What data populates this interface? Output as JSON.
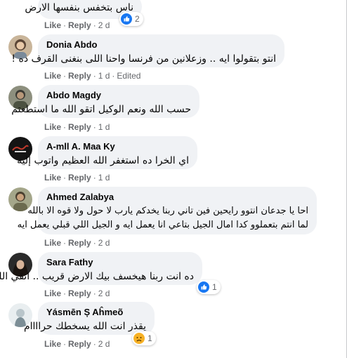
{
  "actions": {
    "like": "Like",
    "reply": "Reply",
    "sep": "·"
  },
  "comments": [
    {
      "name": "",
      "lines": [
        "ناس بتخفس بنفسها الارض"
      ],
      "time": "2 d",
      "edited": "",
      "reaction": {
        "icon": "like-icon",
        "count": "2"
      }
    },
    {
      "name": "Donia Abdo",
      "lines": [
        "انتو بتقولوا ايه .. وزعلانين من فرنسا واحنا اللى بنغنى القرف ده !"
      ],
      "time": "1 d",
      "edited": "Edited",
      "reaction": null
    },
    {
      "name": "Abdo Magdy",
      "lines": [
        "حسب الله ونعم الوكيل اتقو الله ما استطعتم"
      ],
      "time": "1 d",
      "edited": "",
      "reaction": null
    },
    {
      "name": "A-mll A. Maa Ky",
      "lines": [
        "اي الخرا ده استغفر الله العظيم واتوب إليه"
      ],
      "time": "1 d",
      "edited": "",
      "reaction": null
    },
    {
      "name": "Ahmed Zalabya",
      "lines": [
        "احا يا جدعان انتوو رايحين فين تاني ربنا يخدكم يارب لا حول ولا قوه الا بالله",
        "لما انتم بتعملوو كدا امال الجيل بتاعي انا يعمل ايه و الجيل اللي قبلي يعمل ايه"
      ],
      "time": "2 d",
      "edited": "",
      "reaction": null
    },
    {
      "name": "Sara Fathy",
      "lines": [
        "ده انت ربنا هيخسف بيك الارض قريب .. اتقي الله"
      ],
      "time": "2 d",
      "edited": "",
      "reaction": {
        "icon": "like-icon",
        "count": "1"
      }
    },
    {
      "name": "Yásmēn Ș Aĥmeõ",
      "lines": [
        "يقذر انت الله يسخطك حراااام"
      ],
      "time": "2 d",
      "edited": "",
      "reaction": {
        "icon": "sad-icon",
        "count": "1"
      }
    }
  ],
  "colors": {
    "bubble": "#f0f2f5",
    "meta": "#65676b",
    "like_blue": "#1877f2",
    "sad_yellow": "#f7b125"
  }
}
